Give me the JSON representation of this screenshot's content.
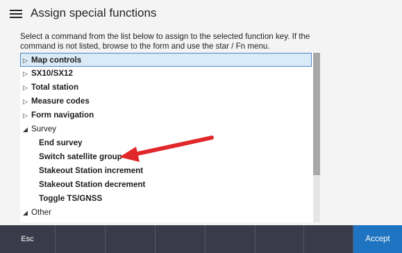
{
  "header": {
    "title": "Assign special functions",
    "menu_icon": "hamburger-menu-icon"
  },
  "instructions": "Select a command from the list below to assign to the selected function key. If the command is not listed, browse to the form and use the star / Fn menu.",
  "list": {
    "items": [
      {
        "label": "Map controls",
        "expander": "▷"
      },
      {
        "label": "SX10/SX12",
        "expander": "▷"
      },
      {
        "label": "Total station",
        "expander": "▷"
      },
      {
        "label": "Measure codes",
        "expander": "▷"
      },
      {
        "label": "Form navigation",
        "expander": "▷"
      },
      {
        "label": "Survey",
        "expander": "◢"
      },
      {
        "label": "End survey"
      },
      {
        "label": "Switch satellite group"
      },
      {
        "label": "Stakeout Station increment"
      },
      {
        "label": "Stakeout Station decrement"
      },
      {
        "label": "Toggle TS/GNSS"
      },
      {
        "label": "Other",
        "expander": "◢"
      }
    ],
    "selected_index": 0
  },
  "annotation": {
    "color": "#e0282a"
  },
  "footer": {
    "esc_label": "Esc",
    "accept_label": "Accept",
    "accept_color": "#1e74c0"
  }
}
